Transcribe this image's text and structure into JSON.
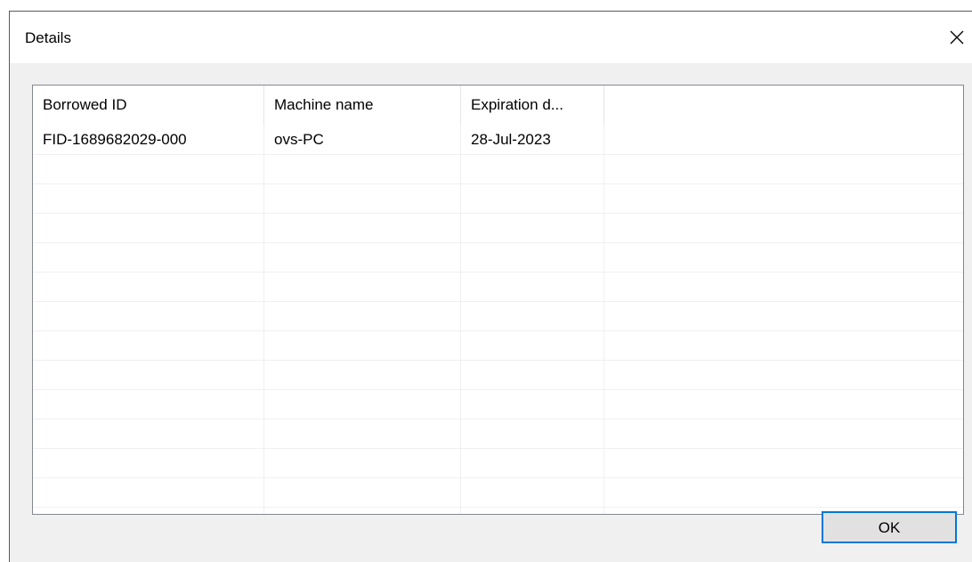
{
  "window": {
    "title": "Details",
    "close_icon": "close-icon"
  },
  "table": {
    "columns": [
      "Borrowed ID",
      "Machine name",
      "Expiration d..."
    ],
    "rows": [
      [
        "FID-1689682029-000",
        "ovs-PC",
        "28-Jul-2023"
      ]
    ]
  },
  "buttons": {
    "ok_label": "OK"
  },
  "colors": {
    "accent": "#0078d7",
    "dialog_bg": "#f0f0f0",
    "list_border": "#828790"
  }
}
